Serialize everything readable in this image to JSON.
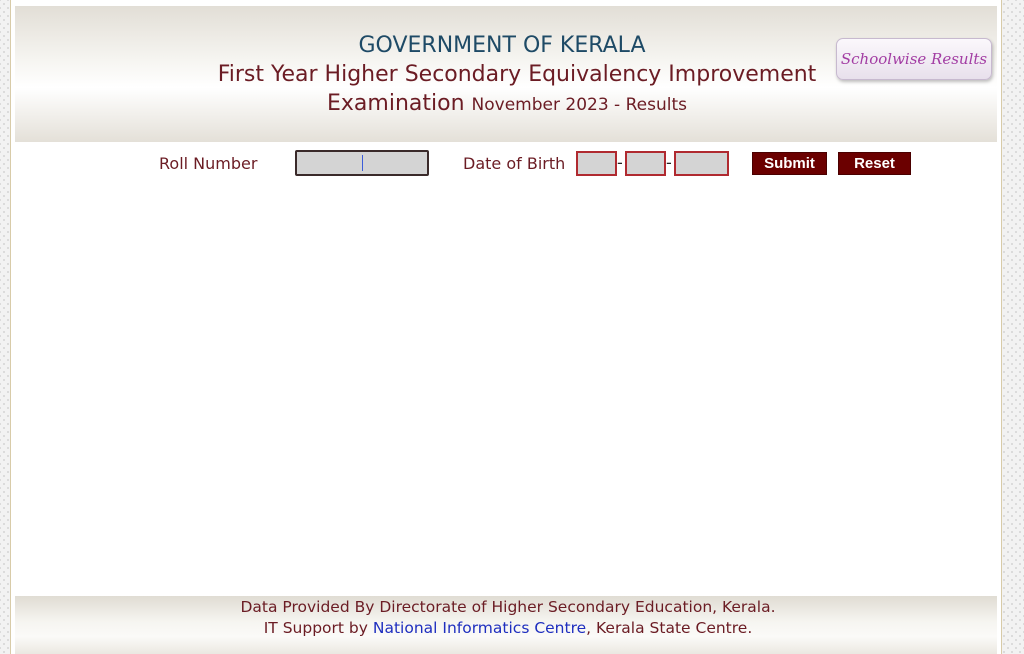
{
  "header": {
    "gov_title": "GOVERNMENT OF KERALA",
    "exam_line1": "First Year Higher Secondary Equivalency Improvement",
    "exam_line2_main": "Examination",
    "exam_line2_small": "November 2023 - Results",
    "schoolwise_button": "Schoolwise Results"
  },
  "form": {
    "roll_number_label": "Roll Number",
    "roll_number_value": "",
    "dob_label": "Date of Birth",
    "dob_day_value": "",
    "dob_month_value": "",
    "dob_year_value": "",
    "separator": "-",
    "submit_label": "Submit",
    "reset_label": "Reset"
  },
  "footer": {
    "line1": "Data Provided By Directorate of Higher Secondary Education, Kerala.",
    "line2_prefix": "IT Support by",
    "line2_link": "National Informatics Centre",
    "line2_suffix": ", Kerala State Centre."
  },
  "colors": {
    "title_blue": "#1e4a66",
    "text_maroon": "#6b1c24",
    "button_bg": "#6b0000",
    "link_blue": "#1f2fbf",
    "schoolwise_text": "#a23da3"
  }
}
